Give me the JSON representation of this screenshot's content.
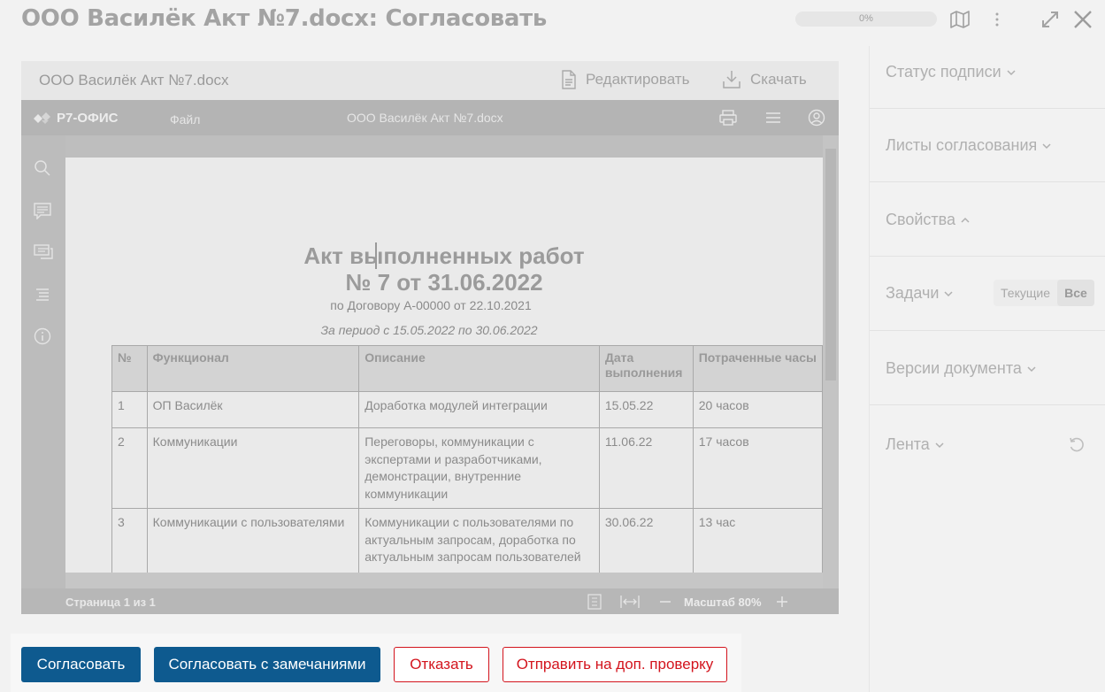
{
  "header": {
    "title": "ООО Василёк Акт №7.docx: Согласовать",
    "progress_label": "0%",
    "progress_value": 0,
    "icons": [
      "map-icon",
      "more-vertical-icon",
      "expand-icon",
      "close-icon"
    ]
  },
  "viewer": {
    "doc_name": "ООО Василёк Акт №7.docx",
    "edit_label": "Редактировать",
    "download_label": "Скачать",
    "editor": {
      "brand": "Р7-ОФИС",
      "file_menu": "Файл",
      "doc_name": "ООО Василёк Акт №7.docx",
      "toolbar_icons": [
        "print-icon",
        "menu-icon",
        "user-icon"
      ],
      "rail_icons": [
        "search-icon",
        "comment-icon",
        "chat-icon",
        "navigation-icon",
        "info-icon"
      ]
    },
    "document": {
      "title_line1": "Акт выполненных работ",
      "title_line2": "№ 7 от 31.06.2022",
      "contract_line": "по Договору А-00000 от 22.10.2021",
      "period_line": "За период с 15.05.2022 по 30.06.2022",
      "table": {
        "headers": [
          "№",
          "Функционал",
          "Описание",
          "Дата выполнения",
          "Потраченные часы"
        ],
        "rows": [
          [
            "1",
            "ОП Василёк",
            "Доработка модулей интеграции",
            "15.05.22",
            "20 часов"
          ],
          [
            "2",
            "Коммуникации",
            "Переговоры, коммуникации с экспертами и разработчиками, демонстрации, внутренние коммуникации",
            "11.06.22",
            "17 часов"
          ],
          [
            "3",
            "Коммуникации с пользователями",
            "Коммуникации с пользователями по актуальным запросам, доработка по актуальным запросам пользователей",
            "30.06.22",
            "13 час"
          ]
        ]
      }
    },
    "status_bar": {
      "page_label": "Страница 1 из 1",
      "zoom_label": "Масштаб 80%"
    }
  },
  "actions": {
    "approve": "Согласовать",
    "approve_with_remarks": "Согласовать с замечаниями",
    "reject": "Отказать",
    "send_for_review": "Отправить на доп. проверку"
  },
  "sidebar": {
    "signature_status": "Статус подписи",
    "approval_sheets": "Листы согласования",
    "properties": "Свойства",
    "tasks": "Задачи",
    "tasks_filter": [
      "Текущие",
      "Все"
    ],
    "tasks_filter_active": "Все",
    "versions": "Версии документа",
    "feed": "Лента"
  },
  "colors": {
    "primary_button": "#0e5a8f",
    "danger": "#d3141d",
    "title_gray": "#a3a3a3"
  }
}
